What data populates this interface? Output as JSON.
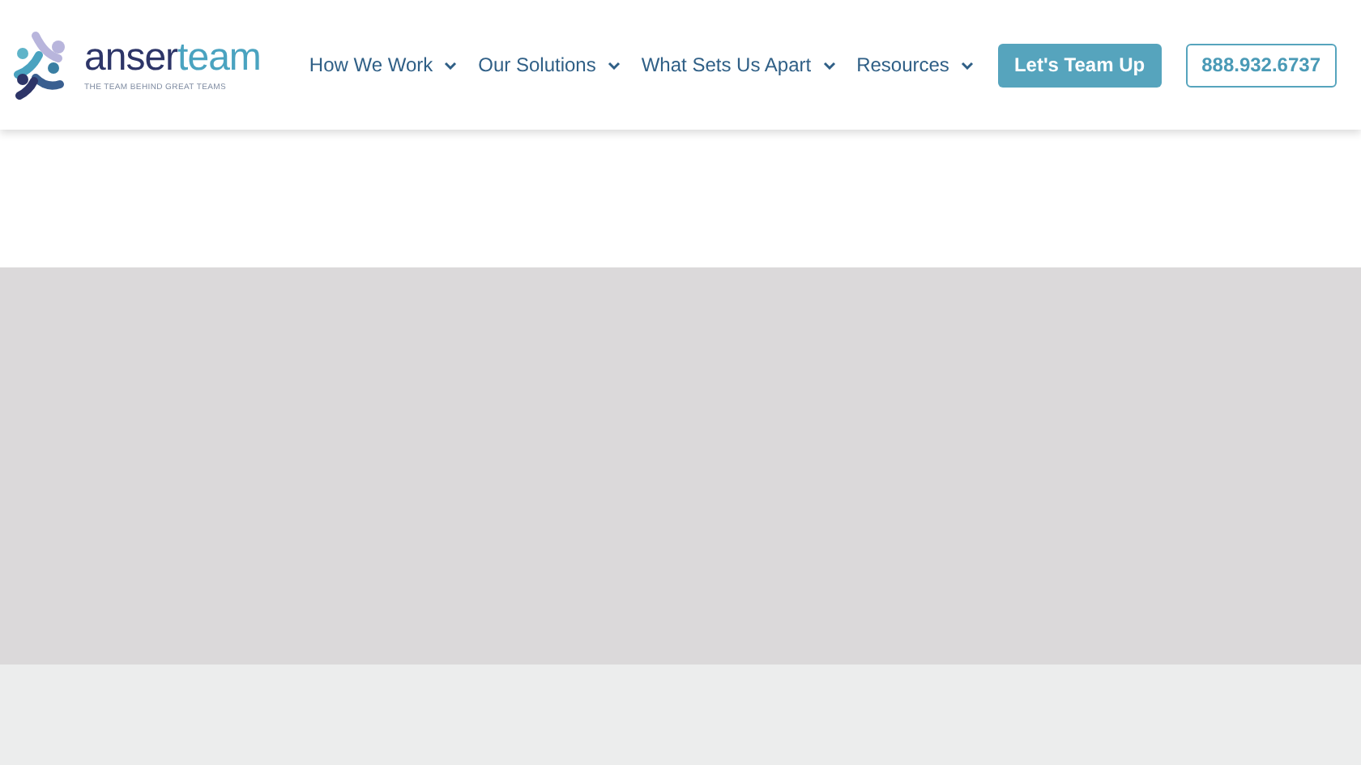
{
  "logo": {
    "prefix": "anser",
    "suffix": "team",
    "tagline": "THE TEAM BEHIND GREAT TEAMS"
  },
  "nav": [
    {
      "label": "How We Work",
      "kind": "dropdown"
    },
    {
      "label": "Our Solutions",
      "kind": "dropdown"
    },
    {
      "label": "What Sets Us Apart",
      "kind": "dropdown"
    },
    {
      "label": "Resources",
      "kind": "dropdown"
    }
  ],
  "cta": {
    "label": "Let's Team Up"
  },
  "phone": {
    "label": "888.932.6737"
  }
}
